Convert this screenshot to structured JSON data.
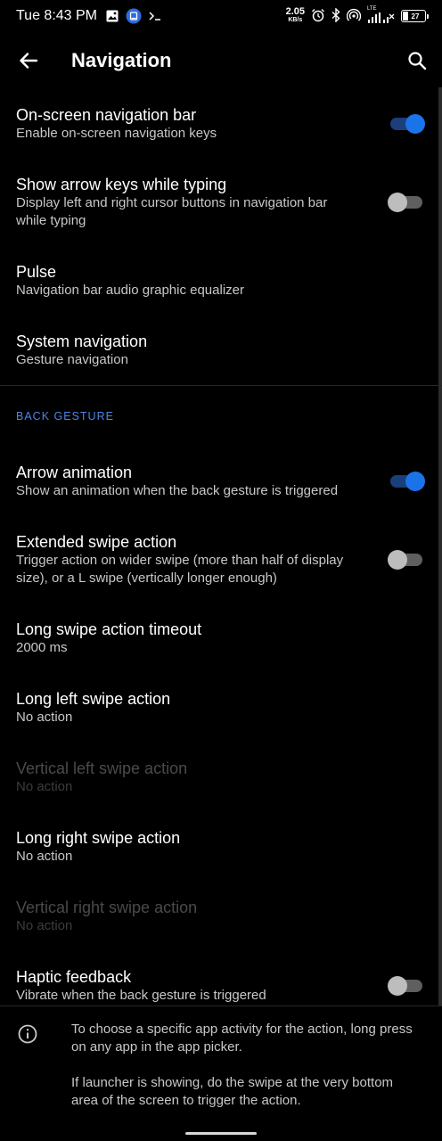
{
  "status_bar": {
    "time": "Tue 8:43 PM",
    "net_speed": "2.05",
    "net_unit": "KB/s",
    "network_type": "LTE",
    "battery": "27",
    "icons": [
      "image-icon",
      "app-notification-icon",
      "terminal-icon",
      "alarm-icon",
      "bluetooth-icon",
      "hotspot-icon",
      "signal-icon",
      "battery-icon"
    ]
  },
  "app_bar": {
    "title": "Navigation",
    "back_icon": "arrow-back-icon",
    "search_icon": "search-icon"
  },
  "colors": {
    "accent": "#1a73e8",
    "section_header": "#4a86e8",
    "background": "#000000"
  },
  "settings": [
    {
      "title": "On-screen navigation bar",
      "summary": "Enable on-screen navigation keys",
      "toggle": "on"
    },
    {
      "title": "Show arrow keys while typing",
      "summary": "Display left and right cursor buttons in navigation bar while typing",
      "toggle": "off"
    },
    {
      "title": "Pulse",
      "summary": "Navigation bar audio graphic equalizer"
    },
    {
      "title": "System navigation",
      "summary": "Gesture navigation"
    }
  ],
  "back_gesture": {
    "header": "BACK GESTURE",
    "items": [
      {
        "title": "Arrow animation",
        "summary": "Show an animation when the back gesture is triggered",
        "toggle": "on"
      },
      {
        "title": "Extended swipe action",
        "summary": "Trigger action on wider swipe (more than half of display size), or a L swipe (vertically longer enough)",
        "toggle": "off"
      },
      {
        "title": "Long swipe action timeout",
        "summary": "2000 ms"
      },
      {
        "title": "Long left swipe action",
        "summary": "No action"
      },
      {
        "title": "Vertical left swipe action",
        "summary": "No action",
        "disabled": true
      },
      {
        "title": "Long right swipe action",
        "summary": "No action"
      },
      {
        "title": "Vertical right swipe action",
        "summary": "No action",
        "disabled": true
      },
      {
        "title": "Haptic feedback",
        "summary": "Vibrate when the back gesture is triggered",
        "toggle": "off"
      }
    ]
  },
  "info": {
    "icon": "info-icon",
    "paragraph1": "To choose a specific app activity for the action, long press on any app in the app picker.",
    "paragraph2": "If launcher is showing, do the swipe at the very bottom area of the screen to trigger the action."
  }
}
